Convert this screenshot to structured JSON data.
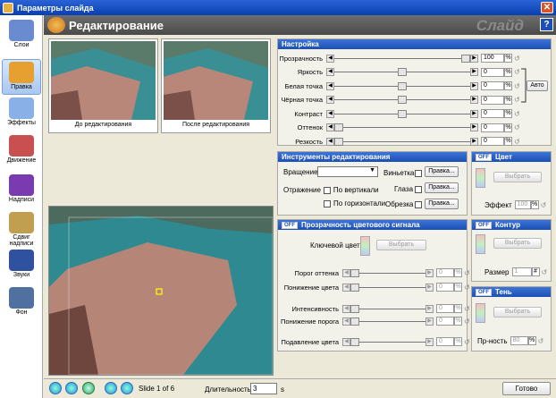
{
  "window": {
    "title": "Параметры слайда"
  },
  "sidebar": {
    "items": [
      {
        "label": "Слои",
        "icon": "layers-icon"
      },
      {
        "label": "Правка",
        "icon": "edit-icon"
      },
      {
        "label": "Эффекты",
        "icon": "effects-icon"
      },
      {
        "label": "Движение",
        "icon": "motion-icon"
      },
      {
        "label": "Надписи",
        "icon": "captions-icon"
      },
      {
        "label": "Сдвиг надписи",
        "icon": "caption-shift-icon"
      },
      {
        "label": "Звуки",
        "icon": "sounds-icon"
      },
      {
        "label": "Фон",
        "icon": "background-icon"
      }
    ]
  },
  "header": {
    "title": "Редактирование",
    "watermark": "Слайд",
    "help": "?"
  },
  "previews": {
    "before": "До редактирования",
    "after": "После редактирования"
  },
  "settings": {
    "title": "Настройка",
    "auto_label": "Авто",
    "rows": [
      {
        "label": "Прозрачность",
        "value": "100",
        "unit": "%",
        "level": 1.0
      },
      {
        "label": "Яркость",
        "value": "0",
        "unit": "%",
        "level": 0.5
      },
      {
        "label": "Белая точка",
        "value": "0",
        "unit": "%",
        "level": 0.5
      },
      {
        "label": "Чёрная точка",
        "value": "0",
        "unit": "%",
        "level": 0.5
      },
      {
        "label": "Контраст",
        "value": "0",
        "unit": "%",
        "level": 0.5
      },
      {
        "label": "Оттенок",
        "value": "0",
        "unit": "%",
        "level": 0.0
      },
      {
        "label": "Резкость",
        "value": "0",
        "unit": "%",
        "level": 0.0
      }
    ]
  },
  "tools": {
    "title": "Инструменты редактирования",
    "rotation_label": "Вращение",
    "reflection_label": "Отражение",
    "vertical_label": "По вертикали",
    "horizontal_label": "По горизонтали",
    "vignette_label": "Виньетка",
    "eyes_label": "Глаза",
    "crop_label": "Обрезка",
    "edit_btn": "Правка..."
  },
  "color": {
    "off": "OFF",
    "title": "Цвет",
    "select": "Выбрать",
    "effect_label": "Эффект",
    "effect_value": "100",
    "unit": "%"
  },
  "chroma": {
    "off": "OFF",
    "title": "Прозрачность цветового сигнала",
    "key_label": "Ключевой цвет",
    "select": "Выбрать",
    "rows": [
      {
        "label": "Порог оттенка",
        "value": "0",
        "unit": "%"
      },
      {
        "label": "Понижение цвета",
        "value": "0",
        "unit": "%"
      },
      {
        "label": "Интенсивность",
        "value": "0",
        "unit": "%"
      },
      {
        "label": "Понижение порога",
        "value": "0",
        "unit": "%"
      },
      {
        "label": "Подавление цвета",
        "value": "0",
        "unit": "%"
      }
    ]
  },
  "outline": {
    "off": "OFF",
    "title": "Контур",
    "select": "Выбрать",
    "size_label": "Размер",
    "size_value": "1",
    "unit": "#"
  },
  "shadow": {
    "off": "OFF",
    "title": "Тень",
    "select": "Выбрать",
    "label": "Пр-ность",
    "value": "80",
    "unit": "%"
  },
  "bottom": {
    "slide_text": "Slide 1 of 6",
    "duration_label": "Длительность",
    "duration_value": "3",
    "duration_unit": "s",
    "done": "Готово"
  }
}
